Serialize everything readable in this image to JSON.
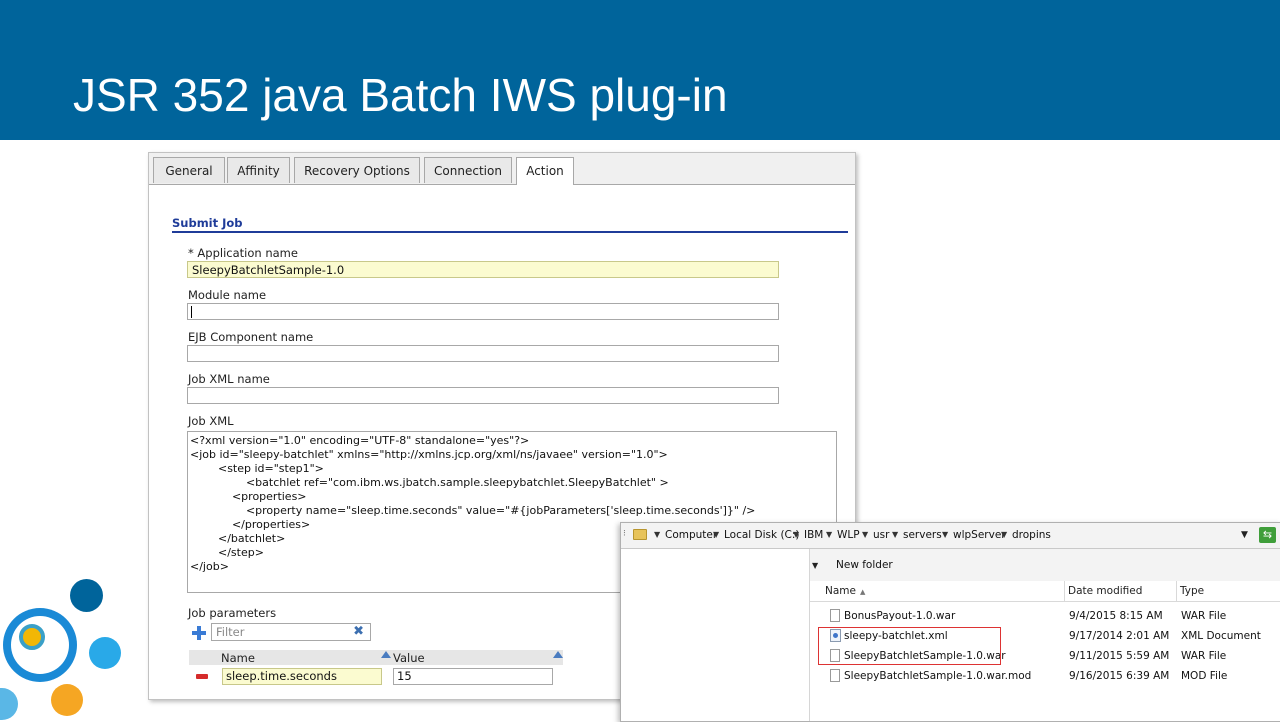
{
  "slide": {
    "title": "JSR 352 java Batch IWS plug-in"
  },
  "colors": {
    "banner": "#00649b",
    "section_title": "#1f3c99",
    "required_field": "#fbfbd0",
    "highlight_box": "#dd3333"
  },
  "panel": {
    "tabs": [
      "General",
      "Affinity",
      "Recovery Options",
      "Connection",
      "Action"
    ],
    "active_tab": "Action",
    "section_title": "Submit Job",
    "fields": {
      "application_name": {
        "label": "* Application name",
        "value": "SleepyBatchletSample-1.0"
      },
      "module_name": {
        "label": "Module name",
        "value": ""
      },
      "ejb_component_name": {
        "label": "EJB Component name",
        "value": ""
      },
      "job_xml_name": {
        "label": "Job XML name",
        "value": ""
      }
    },
    "job_xml": {
      "label": "Job XML",
      "lines": [
        "<?xml version=\"1.0\" encoding=\"UTF-8\" standalone=\"yes\"?>",
        "<job id=\"sleepy-batchlet\" xmlns=\"http://xmlns.jcp.org/xml/ns/javaee\" version=\"1.0\">",
        "        <step id=\"step1\">",
        "                <batchlet ref=\"com.ibm.ws.jbatch.sample.sleepybatchlet.SleepyBatchlet\" >",
        "            <properties>",
        "                <property name=\"sleep.time.seconds\" value=\"#{jobParameters['sleep.time.seconds']}\" />",
        "            </properties>",
        "        </batchlet>",
        "        </step>",
        "</job>"
      ]
    },
    "job_parameters": {
      "label": "Job parameters",
      "filter_placeholder": "Filter",
      "columns": [
        "Name",
        "Value"
      ],
      "rows": [
        {
          "name": "sleep.time.seconds",
          "value": "15"
        }
      ]
    }
  },
  "explorer": {
    "breadcrumb": [
      "Computer",
      "Local Disk (C:)",
      "IBM",
      "WLP",
      "usr",
      "servers",
      "wlpServer",
      "dropins"
    ],
    "toolbar": {
      "new_folder": "New folder"
    },
    "columns": [
      "Name",
      "Date modified",
      "Type"
    ],
    "files": [
      {
        "name": "BonusPayout-1.0.war",
        "date": "9/4/2015 8:15 AM",
        "type": "WAR File",
        "icon": "file-icon"
      },
      {
        "name": "sleepy-batchlet.xml",
        "date": "9/17/2014 2:01 AM",
        "type": "XML Document",
        "icon": "xml-file-icon"
      },
      {
        "name": "SleepyBatchletSample-1.0.war",
        "date": "9/11/2015 5:59 AM",
        "type": "WAR File",
        "icon": "file-icon"
      },
      {
        "name": "SleepyBatchletSample-1.0.war.mod",
        "date": "9/16/2015 6:39 AM",
        "type": "MOD File",
        "icon": "file-icon"
      }
    ]
  }
}
